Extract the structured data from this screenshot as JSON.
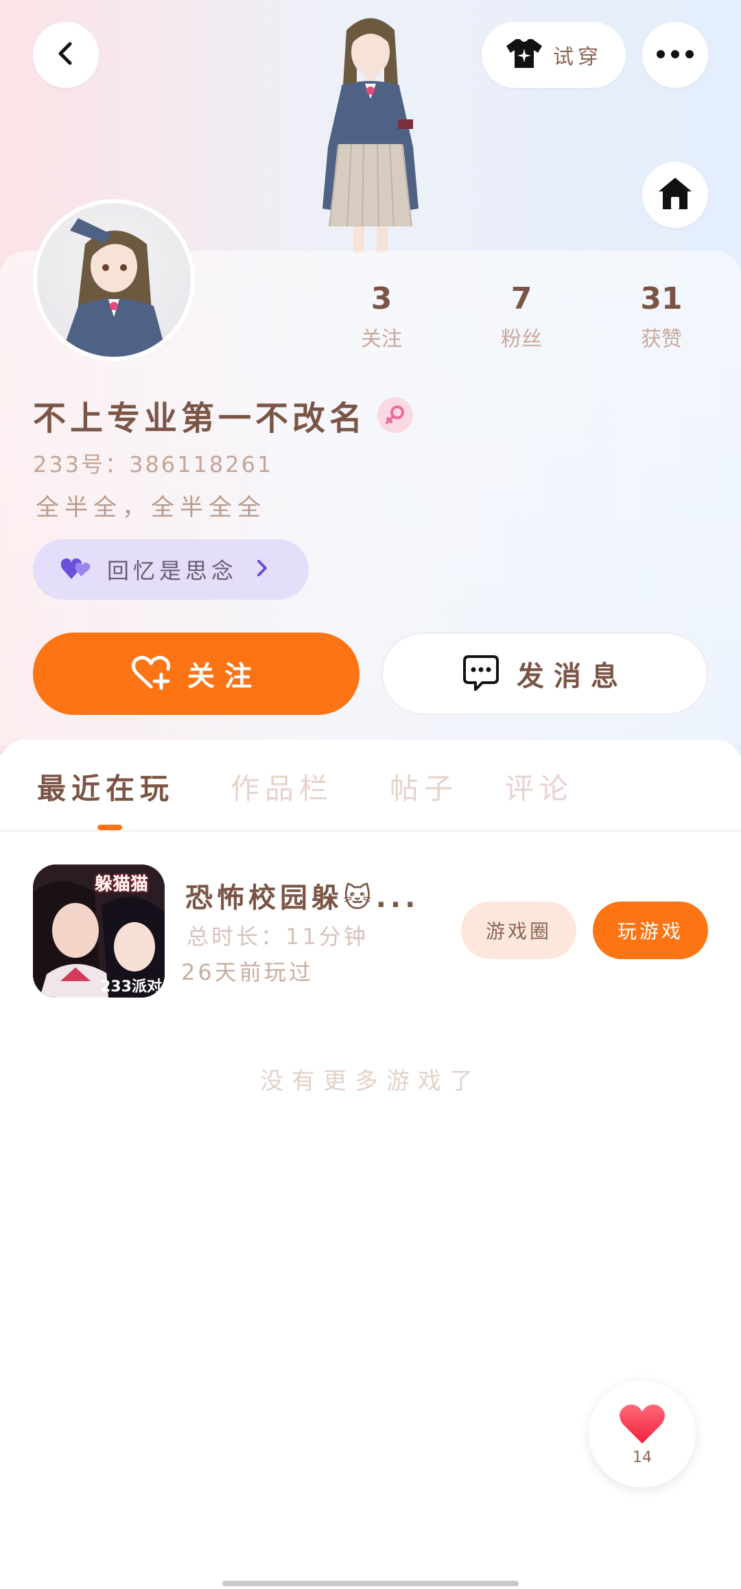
{
  "header": {
    "back_icon": "chevron-left-icon",
    "tryon_label": "试穿",
    "tryon_icon": "tshirt-sparkle-icon",
    "more_icon": "more-dots-icon",
    "home_icon": "home-icon"
  },
  "profile": {
    "name": "不上专业第一不改名",
    "gender_icon": "female-icon",
    "uid": "233号：386118261",
    "bio": "全半全，全半全全",
    "tag_label": "回忆是思念",
    "tag_icon": "double-heart-icon"
  },
  "stats": [
    {
      "value": "3",
      "label": "关注"
    },
    {
      "value": "7",
      "label": "粉丝"
    },
    {
      "value": "31",
      "label": "获赞"
    }
  ],
  "actions": {
    "follow_label": "关注",
    "message_label": "发消息"
  },
  "tabs": [
    {
      "label": "最近在玩",
      "active": true
    },
    {
      "label": "作品栏",
      "active": false
    },
    {
      "label": "帖子",
      "active": false
    },
    {
      "label": "评论",
      "active": false
    }
  ],
  "games": [
    {
      "title": "恐怖校园躲🐱...",
      "playtime": "总时长：11分钟",
      "last_played": "26天前玩过",
      "icon_text_top": "躲猫猫",
      "icon_text_bottom": "233派对",
      "circle_label": "游戏圈",
      "play_label": "玩游戏"
    }
  ],
  "empty_text": "没有更多游戏了",
  "like": {
    "count": "14"
  },
  "colors": {
    "accent": "#fc7414",
    "text_brown": "#7a5545",
    "tag_bg": "#e4defa"
  }
}
